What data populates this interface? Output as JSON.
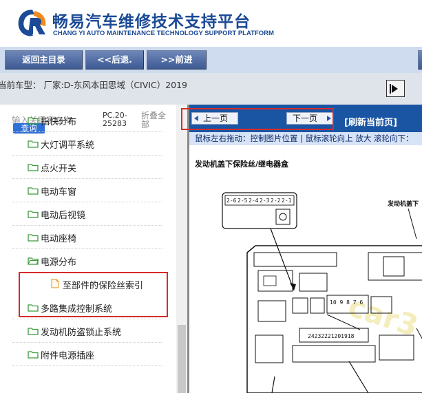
{
  "header": {
    "title": "畅易汽车维修技术支持平台",
    "subtitle": "CHANG YI AUTO MAINTENANCE TECHNOLOGY SUPPORT PLATFORM"
  },
  "nav": {
    "back_home": "返回主目录",
    "prev": "<<后退.",
    "next": ">>前进"
  },
  "vehicle": {
    "text": "当前车型： 厂家:D-东风本田思域（CIVIC）2019"
  },
  "sidebar": {
    "search_placeholder": "输入关键字查询",
    "search_button": "查询",
    "code": "PC.20-25283",
    "collapse_all": "折叠全部",
    "items": [
      {
        "label": "指快分布",
        "type": "folder"
      },
      {
        "label": "大灯调平系统",
        "type": "folder"
      },
      {
        "label": "点火开关",
        "type": "folder"
      },
      {
        "label": "电动车窗",
        "type": "folder"
      },
      {
        "label": "电动后视镜",
        "type": "folder"
      },
      {
        "label": "电动座椅",
        "type": "folder"
      },
      {
        "label": "电源分布",
        "type": "folder",
        "open": true
      },
      {
        "label": "至部件的保险丝索引",
        "type": "file"
      },
      {
        "label": "多路集成控制系统",
        "type": "folder"
      },
      {
        "label": "发动机防盗锁止系统",
        "type": "folder"
      },
      {
        "label": "附件电源插座",
        "type": "folder"
      }
    ]
  },
  "viewer": {
    "prev_page": "上一页",
    "next_page": "下一页",
    "refresh": "[刷新当前页]",
    "hint": "鼠标左右拖动：控制图片位置 | 鼠标滚轮向上 放大  滚轮向下：",
    "diagram_title": "发动机盖下保险丝/继电器盒",
    "callout": "发动机盖下",
    "fuse_top_labels": [
      "2-6",
      "2-5",
      "2-4",
      "2-3",
      "2-2",
      "2-1"
    ],
    "fuse_mid_labels": "10 9 8 7 6",
    "fuse_bottom_labels": "24232221201918",
    "watermark": "car3"
  },
  "colors": {
    "brand_blue": "#1b4a96",
    "nav_button": "#3d5a93",
    "viewer_bar": "#1a55a3",
    "highlight_red": "#d52b2b"
  }
}
